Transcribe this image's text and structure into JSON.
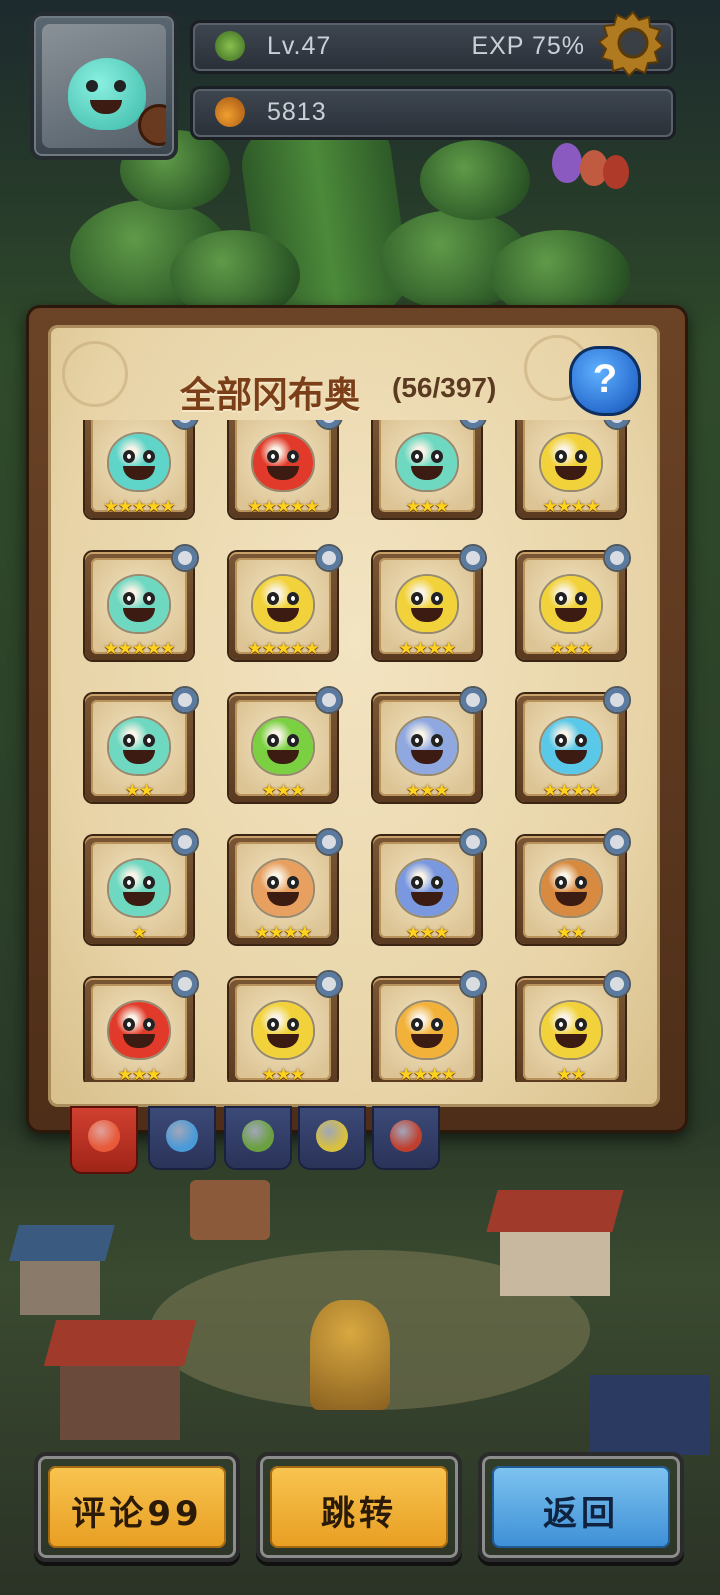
{
  "hud": {
    "level": "Lv.47",
    "exp": "EXP 75%",
    "currency": "5813"
  },
  "panel": {
    "title": "全部冈布奥",
    "count": "(56/397)",
    "help": "?"
  },
  "cards": [
    {
      "color": "#5fd4c8",
      "stars": "★★★★★",
      "element": "shield"
    },
    {
      "color": "#e23a2a",
      "stars": "★★★★★",
      "element": "knight"
    },
    {
      "color": "#6fd8c0",
      "stars": "★★★",
      "element": "crown"
    },
    {
      "color": "#f2d23a",
      "stars": "★★★★",
      "element": "leaf"
    },
    {
      "color": "#6fd8c0",
      "stars": "★★★★★",
      "element": "water"
    },
    {
      "color": "#f2d23a",
      "stars": "★★★★★",
      "element": "sword"
    },
    {
      "color": "#f2d23a",
      "stars": "★★★★",
      "element": "fire"
    },
    {
      "color": "#f2d23a",
      "stars": "★★★",
      "element": "fire"
    },
    {
      "color": "#6fd8c0",
      "stars": "★★",
      "element": "water"
    },
    {
      "color": "#7ad040",
      "stars": "★★★",
      "element": "water"
    },
    {
      "color": "#8fa8e0",
      "stars": "★★★",
      "element": "sword"
    },
    {
      "color": "#5ac8e8",
      "stars": "★★★★",
      "element": "sword"
    },
    {
      "color": "#6fd8c0",
      "stars": "★",
      "element": "fire"
    },
    {
      "color": "#e8a060",
      "stars": "★★★★",
      "element": "water"
    },
    {
      "color": "#7a98e0",
      "stars": "★★★",
      "element": "sword"
    },
    {
      "color": "#d88a40",
      "stars": "★★",
      "element": "fire"
    },
    {
      "color": "#e23a2a",
      "stars": "★★★",
      "element": "water"
    },
    {
      "color": "#f2d23a",
      "stars": "★★★",
      "element": "fire"
    },
    {
      "color": "#f2b23a",
      "stars": "★★★★",
      "element": "sword"
    },
    {
      "color": "#f2d23a",
      "stars": "★★",
      "element": "water"
    }
  ],
  "tabs": [
    {
      "name": "all",
      "color": "#e85a3a"
    },
    {
      "name": "water",
      "color": "#4a9ad8"
    },
    {
      "name": "leaf",
      "color": "#6aa040"
    },
    {
      "name": "star",
      "color": "#d8c040"
    },
    {
      "name": "fire",
      "color": "#c04030"
    }
  ],
  "buttons": {
    "comment": "评论99",
    "jump": "跳转",
    "back": "返回"
  },
  "colors": {
    "panel_wood": "#5a3a20",
    "parchment": "#efdfb8",
    "star": "#ffd21e",
    "gold_button": "#f0b236",
    "blue_button": "#5aa8e2"
  }
}
